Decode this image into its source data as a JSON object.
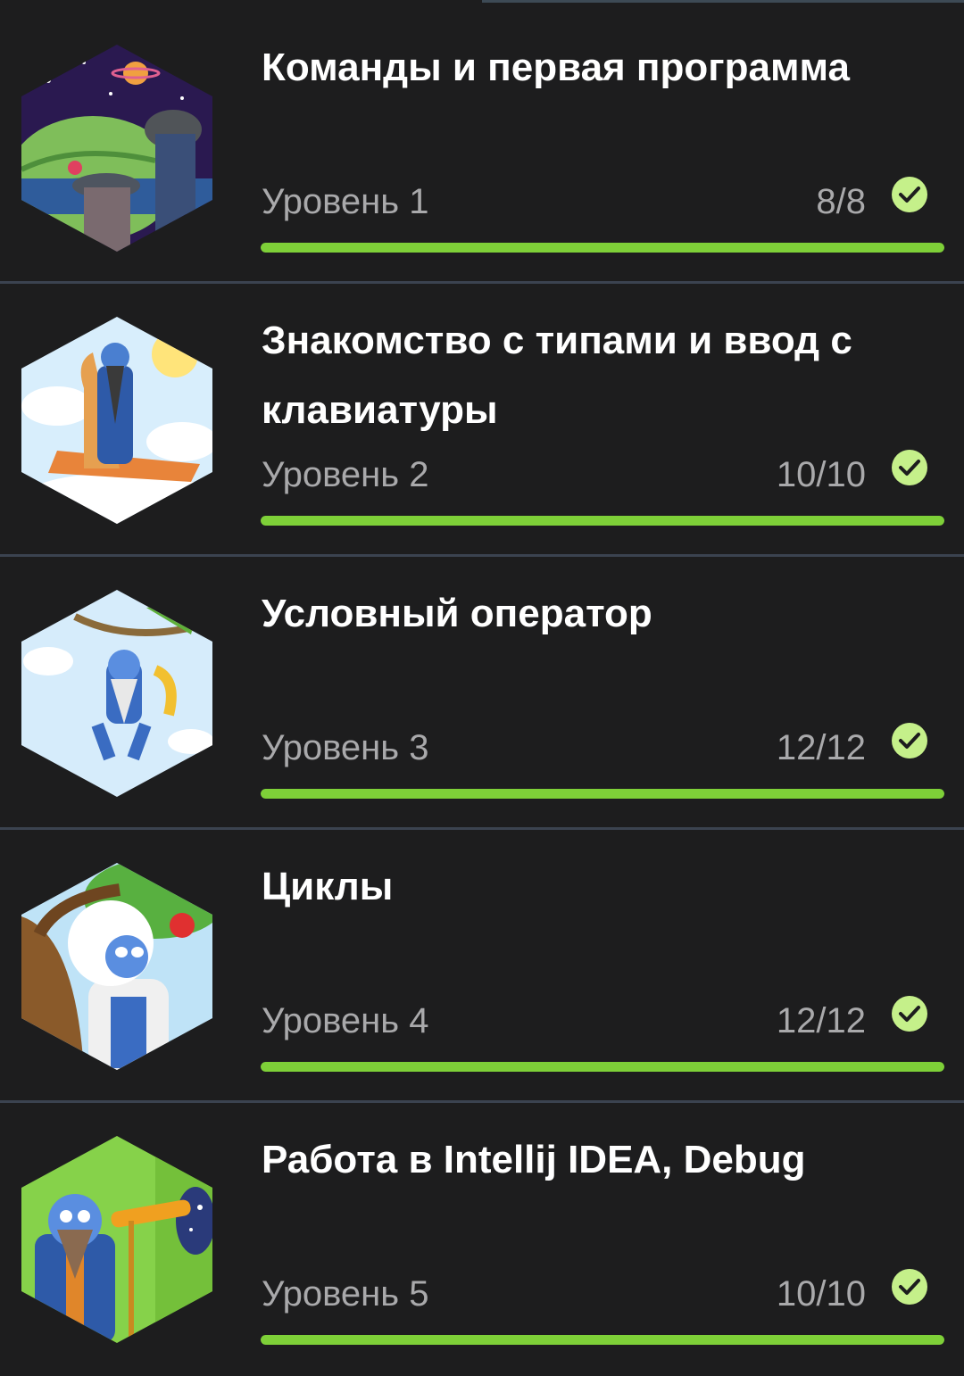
{
  "colors": {
    "background": "#1d1d1e",
    "progress": "#7ed038",
    "check": "#c5f08a",
    "title": "#ffffff",
    "secondary": "#a9a9ab",
    "divider": "#3b4350"
  },
  "lessons": [
    {
      "title": "Команды и первая программа",
      "level": "Уровень 1",
      "count": "8/8",
      "progress": 1.0,
      "completed": true,
      "icon": "check-circle-icon"
    },
    {
      "title": "Знакомство с типами и ввод с клавиатуры",
      "level": "Уровень 2",
      "count": "10/10",
      "progress": 1.0,
      "completed": true,
      "icon": "check-circle-icon"
    },
    {
      "title": "Условный оператор",
      "level": "Уровень 3",
      "count": "12/12",
      "progress": 1.0,
      "completed": true,
      "icon": "check-circle-icon"
    },
    {
      "title": "Циклы",
      "level": "Уровень 4",
      "count": "12/12",
      "progress": 1.0,
      "completed": true,
      "icon": "check-circle-icon"
    },
    {
      "title": "Работа в Intellij IDEA, Debug",
      "level": "Уровень 5",
      "count": "10/10",
      "progress": 1.0,
      "completed": true,
      "icon": "check-circle-icon"
    }
  ]
}
